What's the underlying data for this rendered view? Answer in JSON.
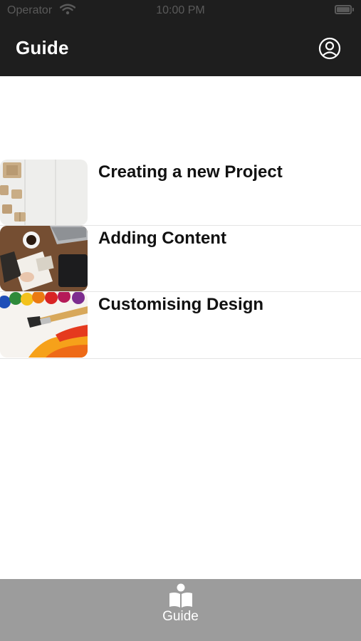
{
  "status_bar": {
    "carrier": "Operator",
    "time": "10:00 PM"
  },
  "nav": {
    "title": "Guide",
    "profile_icon": "user-circle-icon"
  },
  "guides": [
    {
      "title": "Creating a new Project",
      "image": "boxes-on-white-desk-photo"
    },
    {
      "title": "Adding Content",
      "image": "laptop-and-notebook-desk-photo"
    },
    {
      "title": "Customising Design",
      "image": "paints-and-brush-photo"
    }
  ],
  "tab_bar": {
    "tabs": [
      {
        "label": "Guide",
        "icon": "open-book-reader-icon"
      }
    ]
  },
  "colors": {
    "nav_bg": "#1e1e1e",
    "tab_bar_bg": "#9c9c9c",
    "text": "#111111"
  }
}
